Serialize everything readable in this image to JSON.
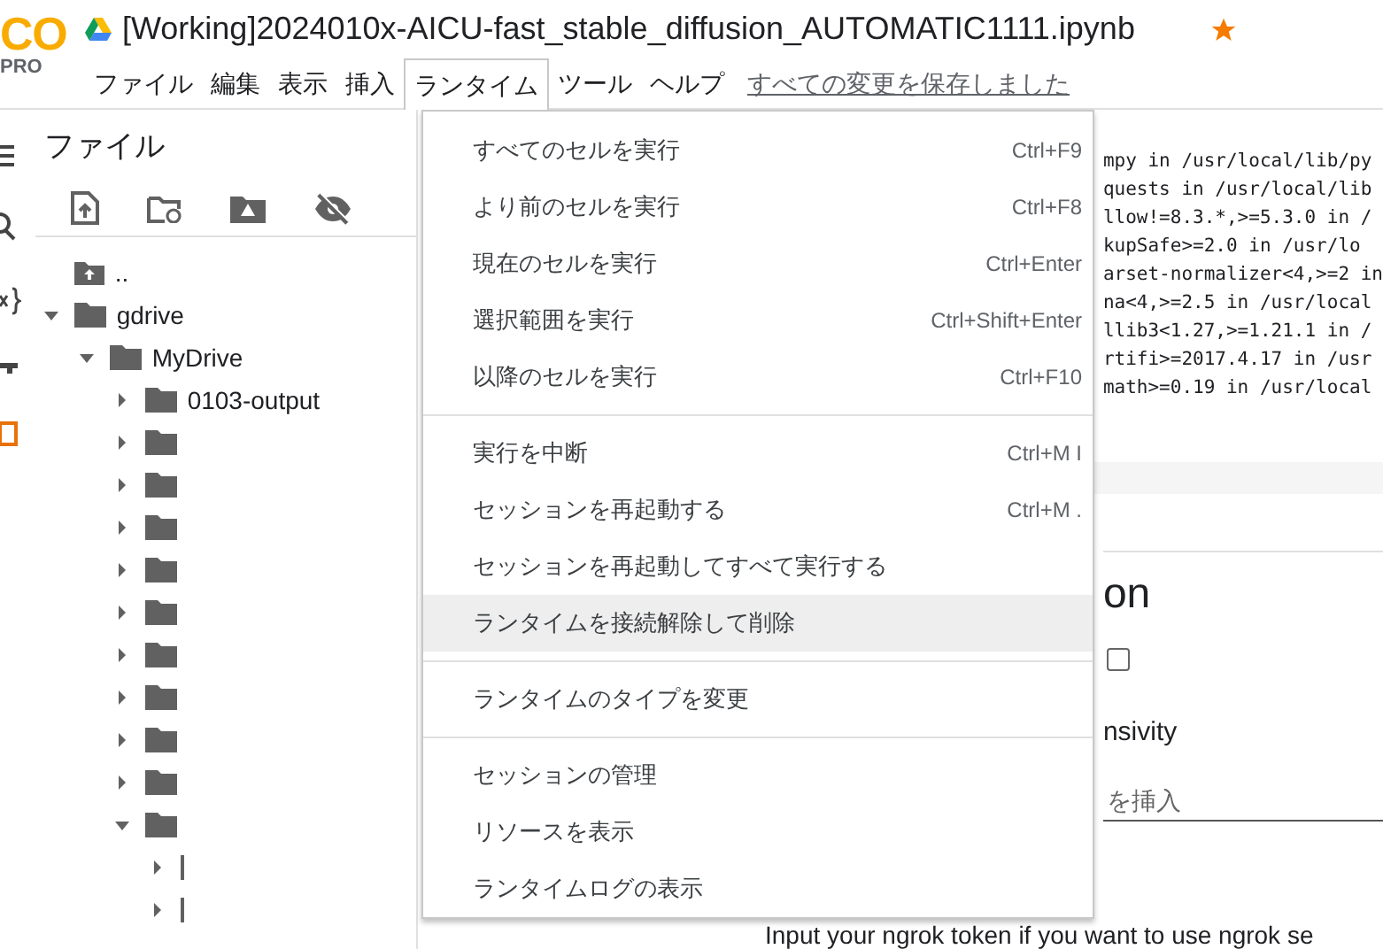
{
  "logo": {
    "mark": "CO",
    "sub": "PRO"
  },
  "title": "[Working]2024010x-AICU-fast_stable_diffusion_AUTOMATIC1111.ipynb",
  "starred": true,
  "menubar": [
    {
      "label": "ファイル",
      "selected": false
    },
    {
      "label": "編集",
      "selected": false
    },
    {
      "label": "表示",
      "selected": false
    },
    {
      "label": "挿入",
      "selected": false
    },
    {
      "label": "ランタイム",
      "selected": true
    },
    {
      "label": "ツール",
      "selected": false
    },
    {
      "label": "ヘルプ",
      "selected": false
    }
  ],
  "save_status": "すべての変更を保存しました",
  "files_panel": {
    "title": "ファイル",
    "tree": [
      {
        "name": "..",
        "kind": "up"
      },
      {
        "name": "gdrive",
        "kind": "folder",
        "expanded": true,
        "children": [
          {
            "name": "MyDrive",
            "kind": "folder",
            "expanded": true,
            "children": [
              {
                "name": "0103-output",
                "kind": "folder",
                "expanded": false
              },
              {
                "kind": "folder",
                "expanded": false
              },
              {
                "kind": "folder",
                "expanded": false
              },
              {
                "kind": "folder",
                "expanded": false
              },
              {
                "kind": "folder",
                "expanded": false
              },
              {
                "kind": "folder",
                "expanded": false
              },
              {
                "kind": "folder",
                "expanded": false
              },
              {
                "kind": "folder",
                "expanded": false
              },
              {
                "kind": "folder",
                "expanded": false
              },
              {
                "kind": "folder",
                "expanded": false
              },
              {
                "kind": "folder",
                "expanded": true,
                "children": [
                  {
                    "kind": "item",
                    "expanded": false
                  },
                  {
                    "kind": "item",
                    "expanded": false
                  }
                ]
              }
            ]
          }
        ]
      }
    ]
  },
  "output_lines": [
    "mpy in /usr/local/lib/py",
    "quests in /usr/local/lib",
    "llow!=8.3.*,>=5.3.0 in /",
    "kupSafe>=2.0 in /usr/lo",
    "arset-normalizer<4,>=2 in",
    "na<4,>=2.5 in /usr/local",
    "llib3<1.27,>=1.21.1 in /",
    "rtifi>=2017.4.17 in /usr",
    "math>=0.19 in /usr/local"
  ],
  "form": {
    "heading": "on",
    "checkbox": {
      "checked": false
    },
    "label": "nsivity",
    "input_value": "を挿入",
    "note": "Input your ngrok token if you want to use ngrok se"
  },
  "runtime_menu": [
    [
      {
        "label": "すべてのセルを実行",
        "shortcut": "Ctrl+F9",
        "highlighted": false
      },
      {
        "label": "より前のセルを実行",
        "shortcut": "Ctrl+F8",
        "highlighted": false
      },
      {
        "label": "現在のセルを実行",
        "shortcut": "Ctrl+Enter",
        "highlighted": false
      },
      {
        "label": "選択範囲を実行",
        "shortcut": "Ctrl+Shift+Enter",
        "highlighted": false
      },
      {
        "label": "以降のセルを実行",
        "shortcut": "Ctrl+F10",
        "highlighted": false
      }
    ],
    [
      {
        "label": "実行を中断",
        "shortcut": "Ctrl+M I",
        "highlighted": false
      },
      {
        "label": "セッションを再起動する",
        "shortcut": "Ctrl+M .",
        "highlighted": false
      },
      {
        "label": "セッションを再起動してすべて実行する",
        "highlighted": false
      },
      {
        "label": "ランタイムを接続解除して削除",
        "highlighted": true
      }
    ],
    [
      {
        "label": "ランタイムのタイプを変更",
        "highlighted": false
      }
    ],
    [
      {
        "label": "セッションの管理",
        "highlighted": false
      },
      {
        "label": "リソースを表示",
        "highlighted": false
      },
      {
        "label": "ランタイムログの表示",
        "highlighted": false
      }
    ]
  ]
}
